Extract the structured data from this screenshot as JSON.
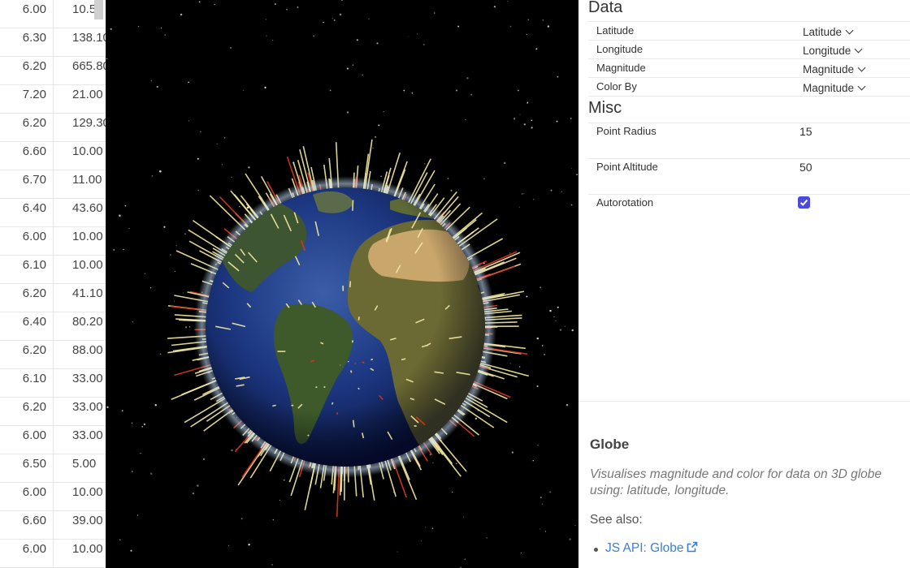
{
  "table": {
    "rows": [
      {
        "magnitude": "6.00",
        "depth": "10.5"
      },
      {
        "magnitude": "6.30",
        "depth": "138.10"
      },
      {
        "magnitude": "6.20",
        "depth": "665.80"
      },
      {
        "magnitude": "7.20",
        "depth": "21.00"
      },
      {
        "magnitude": "6.20",
        "depth": "129.30"
      },
      {
        "magnitude": "6.60",
        "depth": "10.00"
      },
      {
        "magnitude": "6.70",
        "depth": "11.00"
      },
      {
        "magnitude": "6.40",
        "depth": "43.60"
      },
      {
        "magnitude": "6.00",
        "depth": "10.00"
      },
      {
        "magnitude": "6.10",
        "depth": "10.00"
      },
      {
        "magnitude": "6.20",
        "depth": "41.10"
      },
      {
        "magnitude": "6.40",
        "depth": "80.20"
      },
      {
        "magnitude": "6.20",
        "depth": "88.00"
      },
      {
        "magnitude": "6.10",
        "depth": "33.00"
      },
      {
        "magnitude": "6.20",
        "depth": "33.00"
      },
      {
        "magnitude": "6.00",
        "depth": "33.00"
      },
      {
        "magnitude": "6.50",
        "depth": "5.00"
      },
      {
        "magnitude": "6.00",
        "depth": "10.00"
      },
      {
        "magnitude": "6.60",
        "depth": "39.00"
      },
      {
        "magnitude": "6.00",
        "depth": "10.00"
      }
    ]
  },
  "panel": {
    "data_section": {
      "title": "Data",
      "rows": [
        {
          "label": "Latitude",
          "value": "Latitude"
        },
        {
          "label": "Longitude",
          "value": "Longitude"
        },
        {
          "label": "Magnitude",
          "value": "Magnitude"
        },
        {
          "label": "Color By",
          "value": "Magnitude"
        }
      ]
    },
    "misc_section": {
      "title": "Misc",
      "point_radius": {
        "label": "Point Radius",
        "value": "15"
      },
      "point_altitude": {
        "label": "Point Altitude",
        "value": "50"
      },
      "autorotation": {
        "label": "Autorotation",
        "checked": true
      }
    }
  },
  "docs": {
    "title": "Globe",
    "description": "Visualises magnitude and color for data on 3D globe using: latitude, longitude.",
    "see_also": "See also:",
    "link_label": "JS API: Globe"
  },
  "colors": {
    "accent_checkbox": "#4a4adb",
    "link": "#3b7fd6",
    "spike_low": "#f3e9a0",
    "spike_high": "#d9381e"
  }
}
